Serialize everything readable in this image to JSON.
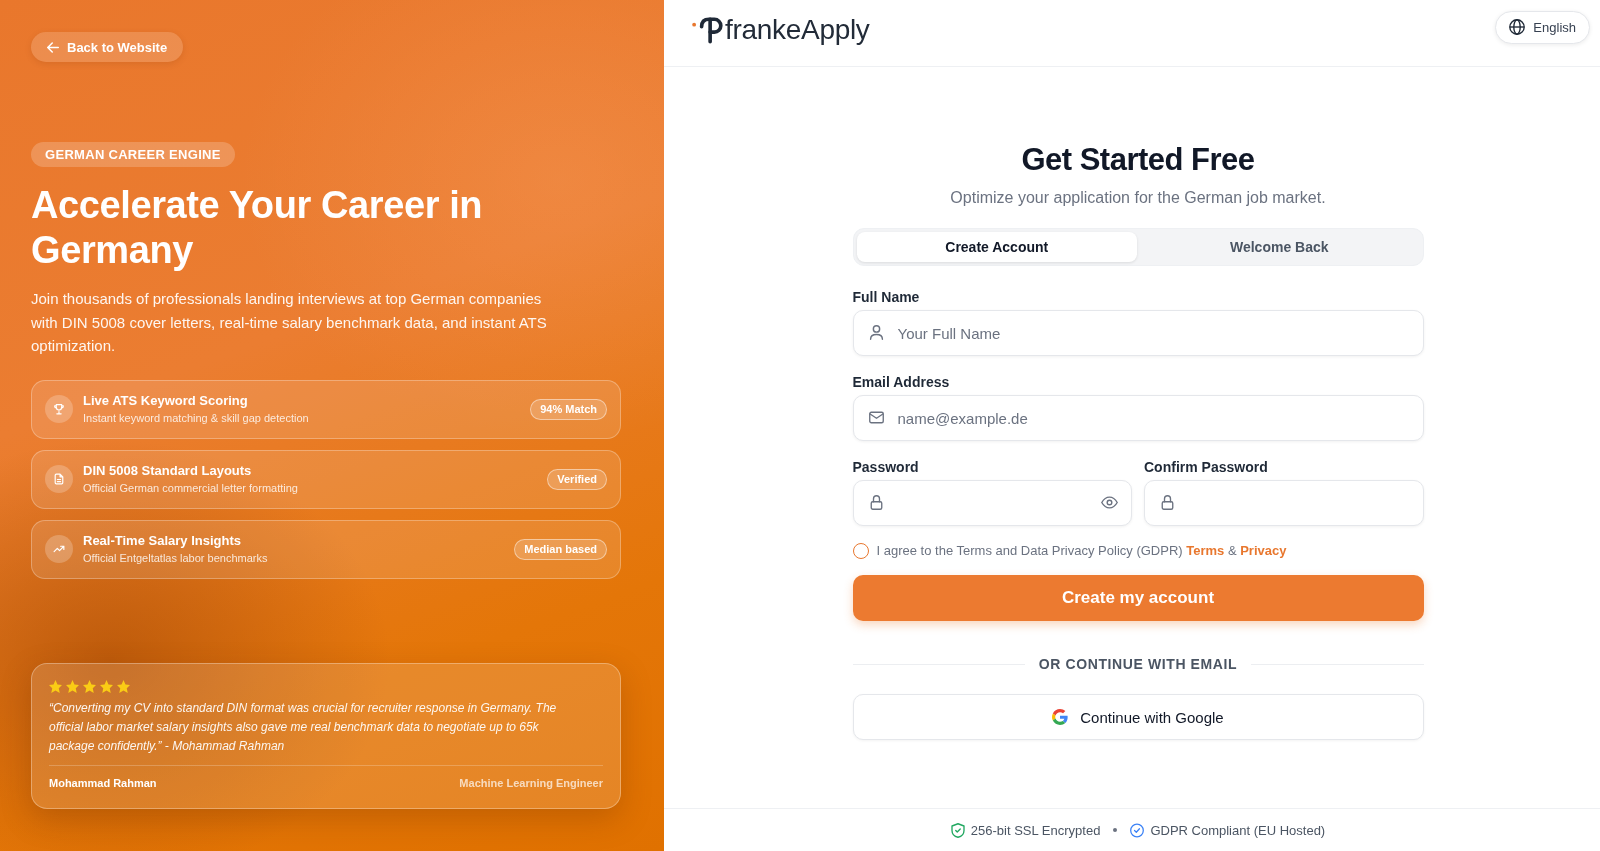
{
  "left_panel": {
    "back_link": "Back to Website",
    "badge": "GERMAN CAREER ENGINE",
    "headline": "Accelerate Your Career in Germany",
    "intro": "Join thousands of professionals landing interviews at top German companies with DIN 5008 cover letters, real-time salary benchmark data, and instant ATS optimization.",
    "features": [
      {
        "title": "Live ATS Keyword Scoring",
        "subtitle": "Instant keyword matching & skill gap detection",
        "tag": "94% Match"
      },
      {
        "title": "DIN 5008 Standard Layouts",
        "subtitle": "Official German commercial letter formatting",
        "tag": "Verified"
      },
      {
        "title": "Real-Time Salary Insights",
        "subtitle": "Official Entgeltatlas labor benchmarks",
        "tag": "Median based"
      }
    ],
    "testimonial": {
      "stars": 5,
      "quote": "“Converting my CV into standard DIN format was crucial for recruiter response in Germany. The official labor market salary insights also gave me real benchmark data to negotiate up to 65k package confidently.” - Mohammad Rahman",
      "author": "Mohammad Rahman",
      "role": "Machine Learning Engineer"
    }
  },
  "header": {
    "logo": "frankeApply",
    "language": "English"
  },
  "signup": {
    "title": "Get Started Free",
    "subtitle": "Optimize your application for the German job market.",
    "tabs": [
      {
        "label": "Create Account",
        "selected": true
      },
      {
        "label": "Welcome Back",
        "selected": false
      }
    ],
    "fields": [
      {
        "kind": "name",
        "label": "Full Name",
        "placeholder": "Your Full Name"
      },
      {
        "kind": "email",
        "label": "Email Address",
        "placeholder": "name@example.de"
      },
      {
        "kind": "password",
        "label": "Password"
      },
      {
        "kind": "confirm",
        "label": "Confirm Password"
      }
    ],
    "consent": {
      "checked": false,
      "text": "I agree to the Terms and Data Privacy Policy (GDPR)",
      "links": [
        "Terms",
        "Privacy"
      ],
      "joiner": "&"
    },
    "submit": "Create my account",
    "divider": "OR CONTINUE WITH EMAIL",
    "google": "Continue with Google"
  },
  "footer": {
    "badges": [
      "256-bit SSL Encrypted",
      "GDPR Compliant (EU Hosted)"
    ]
  }
}
